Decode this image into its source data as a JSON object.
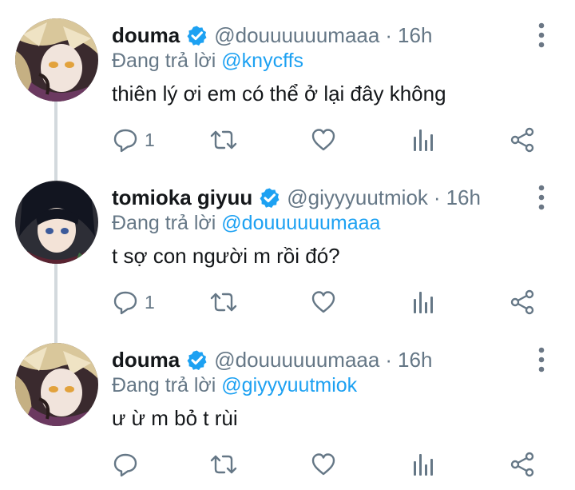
{
  "tweets": [
    {
      "name": "douma",
      "handle": "@douuuuuumaaa",
      "separator": "·",
      "time": "16h",
      "reply_prefix": "Đang trả lời",
      "reply_to": "@knycffs",
      "text": "thiên lý ơi em có thể ở lại đây không",
      "reply_count": "1"
    },
    {
      "name": "tomioka giyuu",
      "handle": "@giyyyuutmiok",
      "separator": "·",
      "time": "16h",
      "reply_prefix": "Đang trả lời",
      "reply_to": "@douuuuuumaaa",
      "text": "t sợ con người m rồi đó?",
      "reply_count": "1"
    },
    {
      "name": "douma",
      "handle": "@douuuuuumaaa",
      "separator": "·",
      "time": "16h",
      "reply_prefix": "Đang trả lời",
      "reply_to": "@giyyyuutmiok",
      "text": "ư ừ m bỏ t rùi",
      "reply_count": ""
    }
  ],
  "icons": {
    "verified": "verified-badge-icon",
    "more": "more-vertical-icon",
    "reply": "reply-bubble-icon",
    "retweet": "retweet-icon",
    "like": "heart-icon",
    "analytics": "bar-chart-icon",
    "share": "share-icon"
  },
  "colors": {
    "accent": "#1da1f2",
    "secondary_text": "#657786",
    "primary_text": "#14171a",
    "thread_line": "#d3d9dd"
  }
}
